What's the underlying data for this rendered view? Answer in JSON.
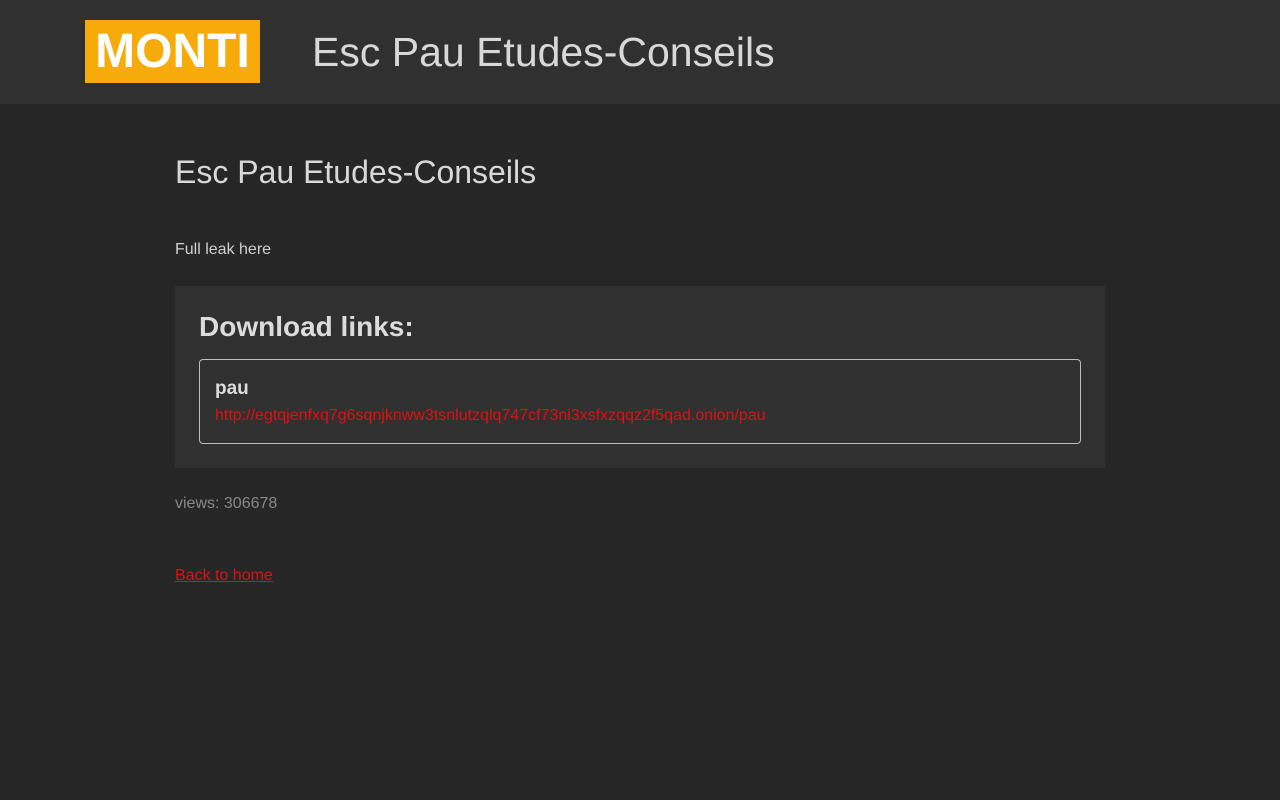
{
  "header": {
    "logo_text": "MONTI",
    "site_title": "Esc Pau Etudes-Conseils"
  },
  "main": {
    "page_title": "Esc Pau Etudes-Conseils",
    "description": "Full leak here",
    "downloads": {
      "heading": "Download links:",
      "items": [
        {
          "name": "pau",
          "url": "http://egtqjenfxq7g6sqnjknww3tsnlutzqlq747cf73ni3xsfxzqqz2f5qad.onion/pau"
        }
      ]
    },
    "views": "views: 306678",
    "back_link": "Back to home"
  },
  "colors": {
    "background": "#262626",
    "header_background": "#303030",
    "logo_background": "#f7ab0a",
    "link": "#e01010",
    "muted_text": "#888888"
  }
}
